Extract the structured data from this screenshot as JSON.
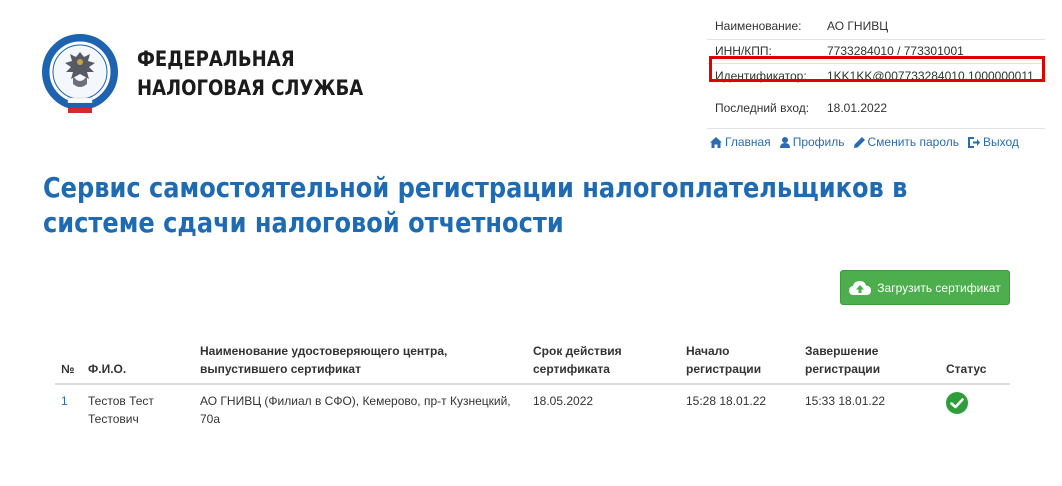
{
  "logo": {
    "line1": "ФЕДЕРАЛЬНАЯ",
    "line2": "НАЛОГОВАЯ СЛУЖБА",
    "emblem_icon": "fns-emblem-icon"
  },
  "info": {
    "name_label": "Наименование:",
    "name_value": "АО ГНИВЦ",
    "inn_label": "ИНН/КПП:",
    "inn_value": "7733284010 / 773301001",
    "id_label": "Идентификатор:",
    "id_value": "1KK1KK@007733284010.1000000011",
    "last_label": "Последний вход:",
    "last_value": "18.01.2022"
  },
  "nav": {
    "home": "Главная",
    "profile": "Профиль",
    "change_password": "Сменить пароль",
    "logout": "Выход"
  },
  "title": "Сервис самостоятельной регистрации налогоплательщиков в системе сдачи налоговой отчетности",
  "upload_button": "Загрузить сертификат",
  "table": {
    "headers": {
      "num": "№",
      "fio": "Ф.И.О.",
      "ca": "Наименование удостоверяющего центра, выпустившего сертификат",
      "expiry": "Срок действия сертификата",
      "start": "Начало регистрации",
      "end": "Завершение регистрации",
      "status": "Статус"
    },
    "rows": [
      {
        "num": "1",
        "fio": "Тестов Тест Тестович",
        "ca": "АО ГНИВЦ (Филиал в СФО), Кемерово, пр-т Кузнецкий, 70а",
        "expiry": "18.05.2022",
        "start": "15:28 18.01.22",
        "end": "15:33 18.01.22",
        "status_icon": "check-circle-icon"
      }
    ]
  },
  "colors": {
    "title": "#1f6bb3",
    "link": "#2b6cb0",
    "button": "#4cae4c",
    "highlight": "#e00000"
  }
}
